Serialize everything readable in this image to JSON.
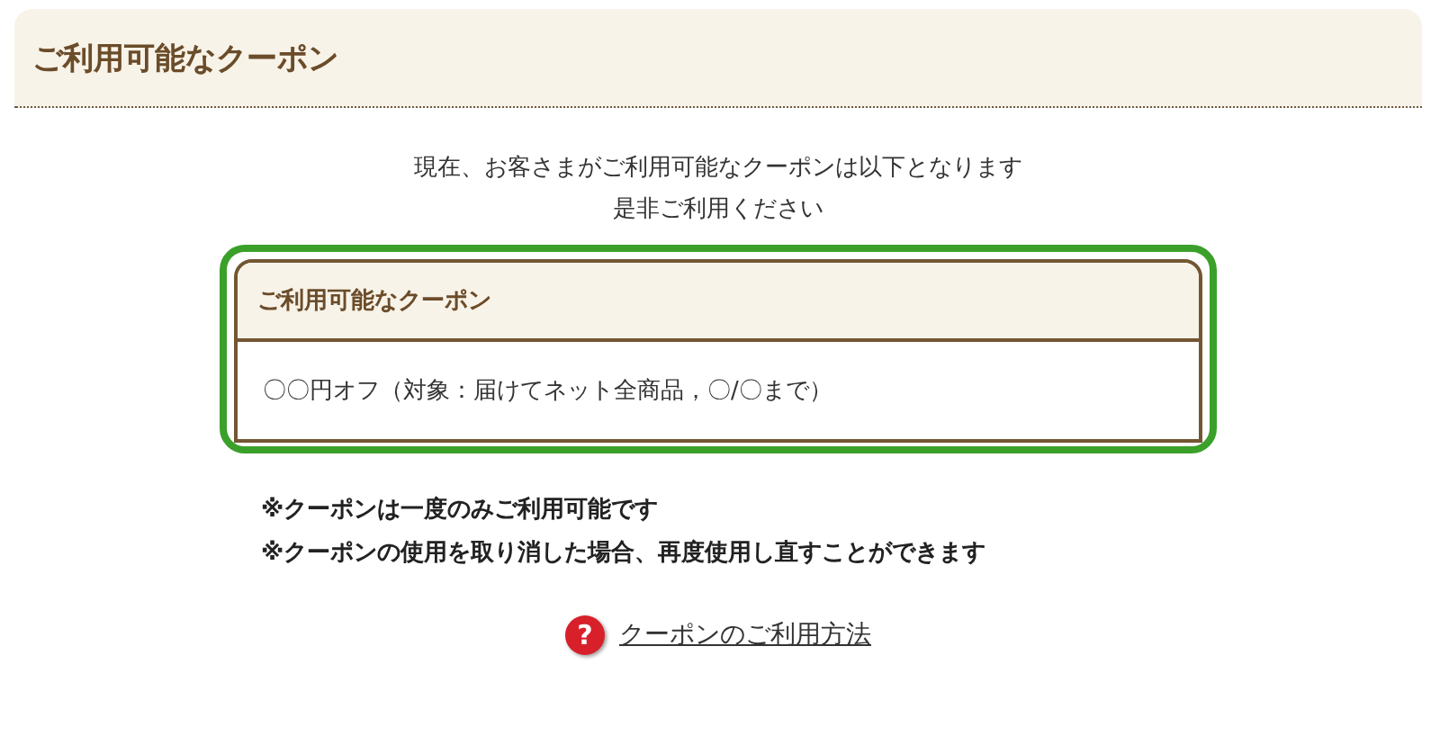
{
  "title": "ご利用可能なクーポン",
  "intro": [
    "現在、お客さまがご利用可能なクーポンは以下となります",
    "是非ご利用ください"
  ],
  "coupon_box": {
    "heading": "ご利用可能なクーポン",
    "coupons": [
      "〇〇円オフ（対象：届けてネット全商品，〇/〇まで）"
    ]
  },
  "notes": [
    "※クーポンは一度のみご利用可能です",
    "※クーポンの使用を取り消した場合、再度使用し直すことができます"
  ],
  "help_link": {
    "icon": "?",
    "label": "クーポンのご利用方法"
  }
}
